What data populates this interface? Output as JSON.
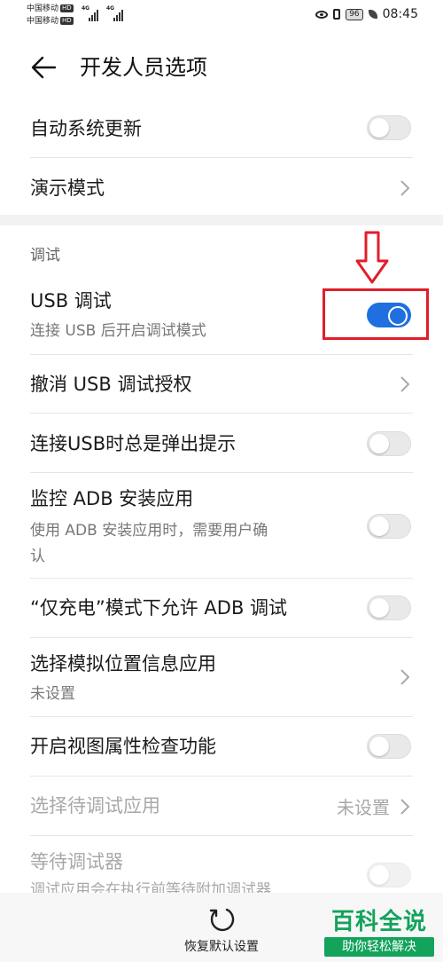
{
  "status_bar": {
    "carrier1": "中国移动",
    "carrier2": "中国移动",
    "network_badge": "HD",
    "signal_label": "4G",
    "battery": "96",
    "time": "08:45"
  },
  "header": {
    "title": "开发人员选项"
  },
  "rows": {
    "auto_update": {
      "label": "自动系统更新",
      "toggle": false
    },
    "demo_mode": {
      "label": "演示模式"
    },
    "debug_section": "调试",
    "usb_debug": {
      "label": "USB 调试",
      "sub": "连接 USB 后开启调试模式",
      "toggle": true
    },
    "revoke_auth": {
      "label": "撤消 USB 调试授权"
    },
    "usb_prompt": {
      "label": "连接USB时总是弹出提示",
      "toggle": false
    },
    "adb_install": {
      "label": "监控 ADB 安装应用",
      "sub1": "使用 ADB 安装应用时，需要用户确",
      "sub2": "认",
      "toggle": false
    },
    "charge_adb": {
      "label": "“仅充电”模式下允许 ADB 调试",
      "toggle": false
    },
    "mock_location": {
      "label": "选择模拟位置信息应用",
      "sub": "未设置"
    },
    "view_attr": {
      "label": "开启视图属性检查功能",
      "toggle": false
    },
    "debug_app": {
      "label": "选择待调试应用",
      "value": "未设置"
    },
    "wait_debugger": {
      "label": "等待调试器",
      "sub": "调试应用会在执行前等待附加调试器",
      "toggle": false
    }
  },
  "bottom": {
    "reset_label": "恢复默认设置"
  },
  "watermark": {
    "title": "百科全说",
    "subtitle": "助你轻松解决"
  },
  "colors": {
    "accent": "#1f6fe0",
    "highlight": "#e01e2b",
    "watermark": "#13a35b"
  }
}
